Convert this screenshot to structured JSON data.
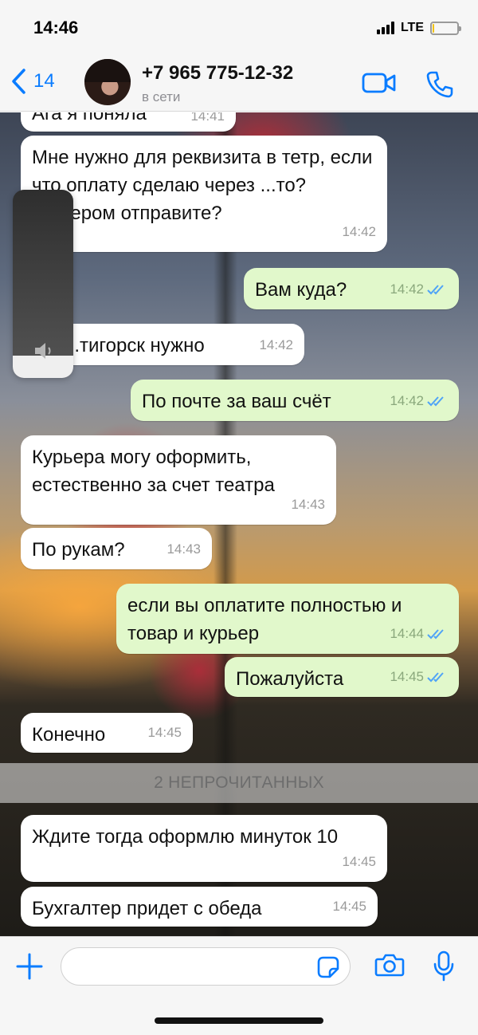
{
  "status_bar": {
    "time": "14:46",
    "network": "LTE",
    "battery_level": 0.08
  },
  "header": {
    "back_count": "14",
    "contact_name": "+7 965 775-12-32",
    "contact_status": "в сети",
    "icons": {
      "back": "chevron-left-icon",
      "video": "video-call-icon",
      "phone": "phone-icon"
    },
    "accent_color": "#0a7cff"
  },
  "messages": [
    {
      "dir": "in",
      "text": "Ага я поняла",
      "time": "14:41"
    },
    {
      "dir": "in",
      "text": "Мне нужно для реквизита в тетр, если что оплату сделаю через ...то? курьером отправите?",
      "time": "14:42"
    },
    {
      "dir": "out",
      "text": "Вам куда?",
      "time": "14:42",
      "status": "read"
    },
    {
      "dir": "in",
      "text": "...тигорск нужно",
      "time": "14:42"
    },
    {
      "dir": "out",
      "text": "По почте за ваш счёт",
      "time": "14:42",
      "status": "read"
    },
    {
      "dir": "in",
      "text": "Курьера могу оформить, естественно за счет театра",
      "time": "14:43"
    },
    {
      "dir": "in",
      "text": "По рукам?",
      "time": "14:43"
    },
    {
      "dir": "out",
      "text": "если вы оплатите полностью и товар и курьер",
      "time": "14:44",
      "status": "read"
    },
    {
      "dir": "out",
      "text": "Пожалуйста",
      "time": "14:45",
      "status": "read"
    },
    {
      "dir": "in",
      "text": "Конечно",
      "time": "14:45"
    },
    {
      "dir": "in",
      "text": "Ждите тогда оформлю минуток 10",
      "time": "14:45"
    },
    {
      "dir": "in",
      "text": "Бухгалтер придет с обеда",
      "time": "14:45"
    }
  ],
  "unread_divider": "2 НЕПРОЧИТАННЫХ",
  "volume_hud": {
    "level": 0.12,
    "icon": "speaker-icon"
  },
  "input_bar": {
    "placeholder": "",
    "icons": {
      "attach": "plus-icon",
      "sticker": "sticker-icon",
      "camera": "camera-icon",
      "mic": "microphone-icon"
    }
  },
  "colors": {
    "outgoing_bubble": "#e1f8cb",
    "incoming_bubble": "#ffffff",
    "read_ticks": "#4fa3f7"
  }
}
